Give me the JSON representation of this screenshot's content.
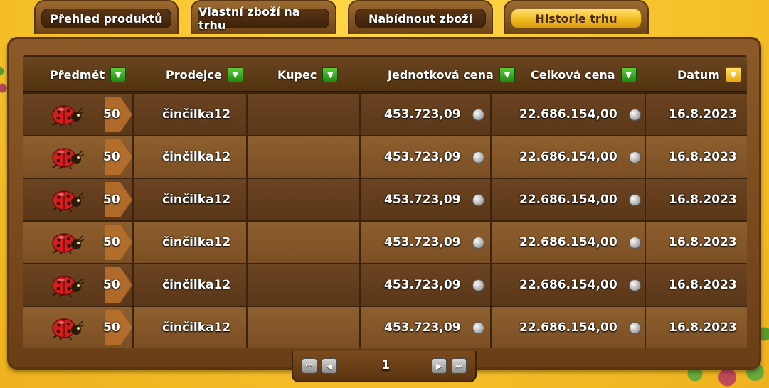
{
  "tabs": [
    {
      "label": "Přehled produktů",
      "active": false
    },
    {
      "label": "Vlastní zboží na trhu",
      "active": false
    },
    {
      "label": "Nabídnout zboží",
      "active": false
    },
    {
      "label": "Historie trhu",
      "active": true
    }
  ],
  "columns": [
    {
      "label": "Předmět",
      "sort_active": false
    },
    {
      "label": "Prodejce",
      "sort_active": false
    },
    {
      "label": "Kupec",
      "sort_active": false
    },
    {
      "label": "Jednotková cena",
      "sort_active": false
    },
    {
      "label": "Celková cena",
      "sort_active": false
    },
    {
      "label": "Datum",
      "sort_active": true
    }
  ],
  "rows": [
    {
      "item_icon": "ladybug-icon",
      "quantity": "50",
      "seller": "činčilka12",
      "buyer": "",
      "unit_price": "453.723,09",
      "total_price": "22.686.154,00",
      "date": "16.8.2023"
    },
    {
      "item_icon": "ladybug-icon",
      "quantity": "50",
      "seller": "činčilka12",
      "buyer": "",
      "unit_price": "453.723,09",
      "total_price": "22.686.154,00",
      "date": "16.8.2023"
    },
    {
      "item_icon": "ladybug-icon",
      "quantity": "50",
      "seller": "činčilka12",
      "buyer": "",
      "unit_price": "453.723,09",
      "total_price": "22.686.154,00",
      "date": "16.8.2023"
    },
    {
      "item_icon": "ladybug-icon",
      "quantity": "50",
      "seller": "činčilka12",
      "buyer": "",
      "unit_price": "453.723,09",
      "total_price": "22.686.154,00",
      "date": "16.8.2023"
    },
    {
      "item_icon": "ladybug-icon",
      "quantity": "50",
      "seller": "činčilka12",
      "buyer": "",
      "unit_price": "453.723,09",
      "total_price": "22.686.154,00",
      "date": "16.8.2023"
    },
    {
      "item_icon": "ladybug-icon",
      "quantity": "50",
      "seller": "činčilka12",
      "buyer": "",
      "unit_price": "453.723,09",
      "total_price": "22.686.154,00",
      "date": "16.8.2023"
    }
  ],
  "pagination": {
    "current_page": "1",
    "first_icon": "first-page-icon",
    "prev_icon": "prev-page-icon",
    "next_icon": "next-page-icon",
    "last_icon": "last-page-icon"
  },
  "colors": {
    "background": "#f5c02a",
    "wood_dark": "#5a3718",
    "wood_light": "#7a4f24",
    "sort_green": "#1e8a12",
    "sort_active": "#e8a810"
  }
}
